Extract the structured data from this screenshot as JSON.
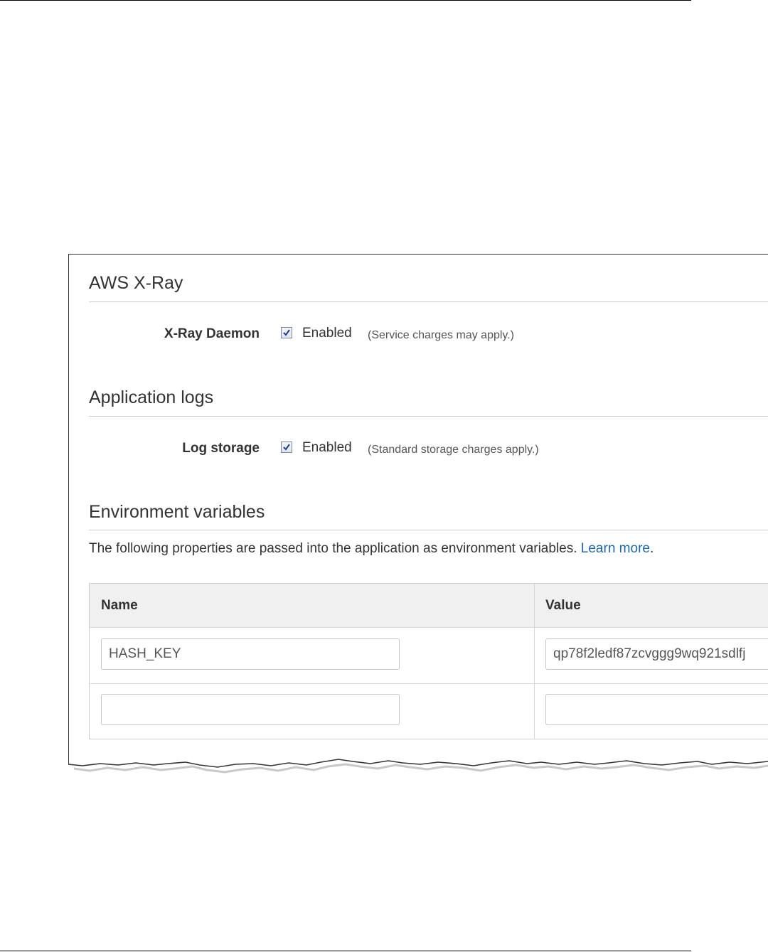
{
  "xray": {
    "title": "AWS X-Ray",
    "daemon_label": "X-Ray Daemon",
    "daemon_enabled": true,
    "daemon_enabled_label": "Enabled",
    "daemon_note": "(Service charges may apply.)"
  },
  "app_logs": {
    "title": "Application logs",
    "storage_label": "Log storage",
    "storage_enabled": true,
    "storage_enabled_label": "Enabled",
    "storage_note": "(Standard storage charges apply.)"
  },
  "env": {
    "title": "Environment variables",
    "description": "The following properties are passed into the application as environment variables.",
    "learn_more": "Learn more",
    "learn_more_suffix": ".",
    "columns": {
      "name": "Name",
      "value": "Value"
    },
    "rows": [
      {
        "name": "HASH_KEY",
        "value": "qp78f2ledf87zcvggg9wq921sdlfj"
      },
      {
        "name": "",
        "value": ""
      }
    ]
  }
}
